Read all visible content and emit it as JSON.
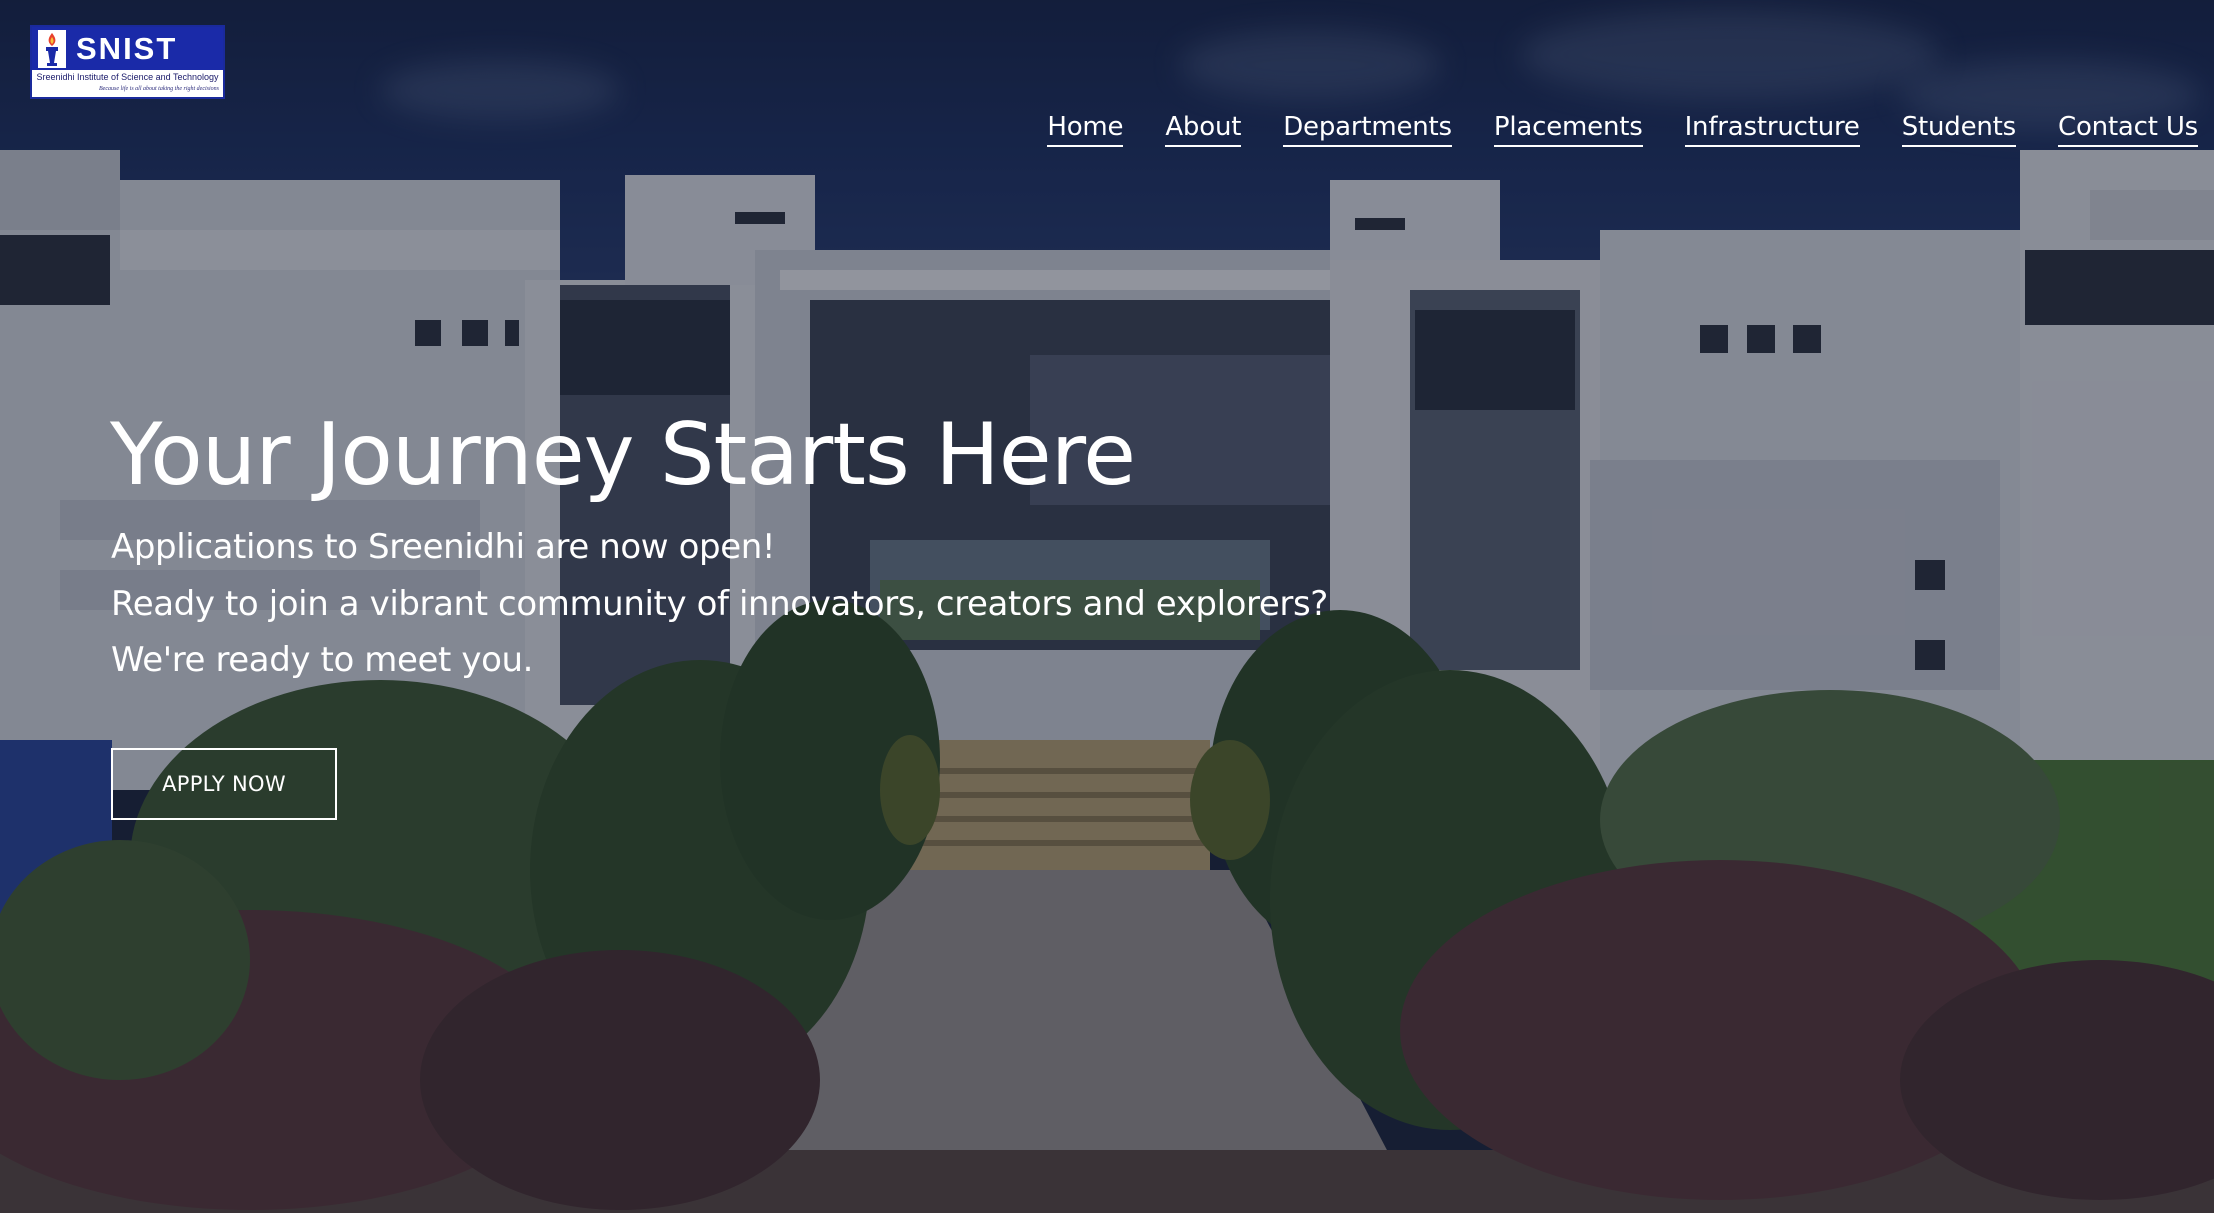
{
  "logo": {
    "wordmark": "SNIST",
    "institute_name": "Sreenidhi Institute of Science and Technology",
    "tagline": "Because life is all about taking the right decisions",
    "icon": "torch-icon"
  },
  "nav": {
    "items": [
      {
        "label": "Home"
      },
      {
        "label": "About"
      },
      {
        "label": "Departments"
      },
      {
        "label": "Placements"
      },
      {
        "label": "Infrastructure"
      },
      {
        "label": "Students"
      },
      {
        "label": "Contact Us"
      }
    ]
  },
  "hero": {
    "title": "Your Journey Starts Here",
    "lines": [
      "Applications to Sreenidhi are now open!",
      "Ready to join a vibrant community of innovators, creators and explorers?",
      "We're ready to meet you."
    ],
    "cta_label": "APPLY NOW"
  },
  "colors": {
    "logo_blue": "#1a2aa8",
    "text": "#ffffff",
    "overlay": "#0e1222"
  }
}
